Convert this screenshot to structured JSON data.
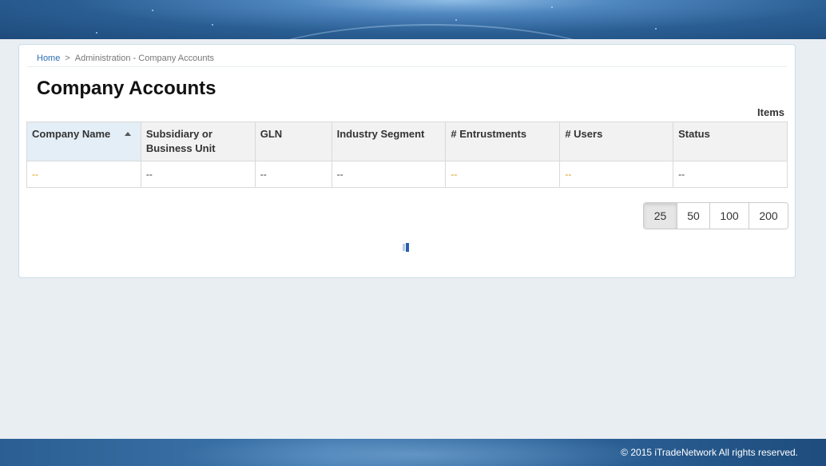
{
  "breadcrumb": {
    "home": "Home",
    "separator": ">",
    "current": "Administration - Company Accounts"
  },
  "page_title": "Company Accounts",
  "items_label": "Items",
  "table": {
    "columns": [
      "Company Name",
      "Subsidiary or Business Unit",
      "GLN",
      "Industry Segment",
      "# Entrustments",
      "# Users",
      "Status"
    ],
    "sorted_column": "Company Name",
    "sort_direction": "ascending",
    "rows": [
      [
        "--",
        "--",
        "--",
        "--",
        "--",
        "--",
        "--"
      ]
    ]
  },
  "pager": {
    "options": [
      "25",
      "50",
      "100",
      "200"
    ],
    "selected": "25"
  },
  "footer": {
    "copyright": "© 2015 iTradeNetwork All rights reserved."
  },
  "colors": {
    "link": "#2a6db5",
    "cell_link": "#d99b00",
    "banner": "#2a5e93"
  }
}
